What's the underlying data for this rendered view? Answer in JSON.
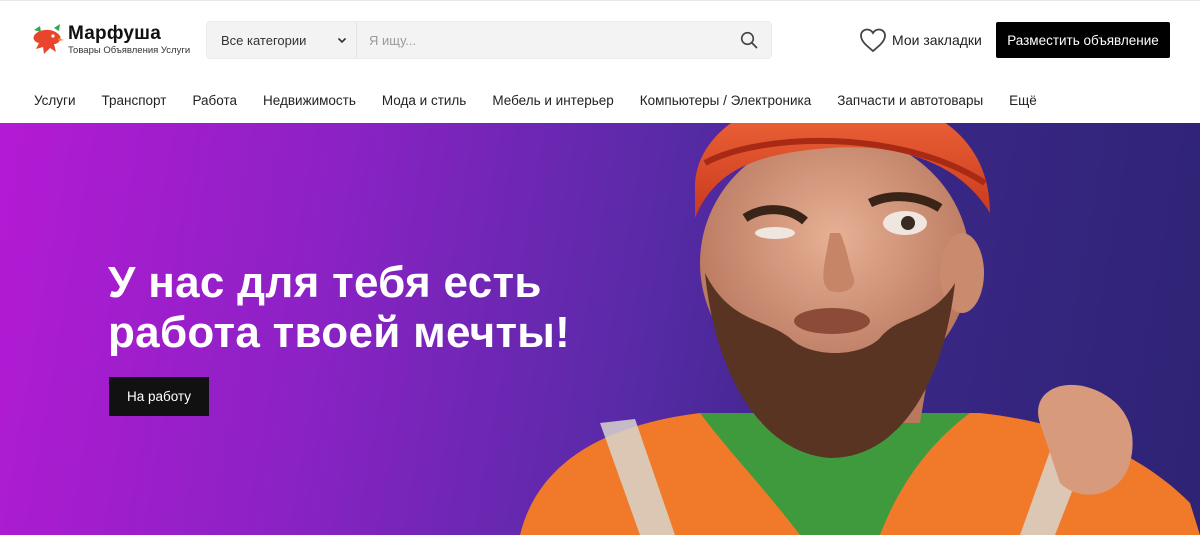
{
  "brand": {
    "name": "Марфуша",
    "tagline": "Товары Объявления Услуги",
    "logo_icon": "dragon-logo-icon"
  },
  "search": {
    "category_label": "Все категории",
    "placeholder": "Я ищу...",
    "value": ""
  },
  "header": {
    "bookmarks_label": "Мои закладки",
    "post_ad_label": "Разместить объявление"
  },
  "nav": {
    "items": [
      {
        "label": "Услуги"
      },
      {
        "label": "Транспорт"
      },
      {
        "label": "Работа"
      },
      {
        "label": "Недвижимость"
      },
      {
        "label": "Мода и стиль"
      },
      {
        "label": "Мебель и интерьер"
      },
      {
        "label": "Компьютеры / Электроника"
      },
      {
        "label": "Запчасти и автотовары"
      },
      {
        "label": "Ещё"
      }
    ]
  },
  "hero": {
    "title_line1": "У нас для тебя есть",
    "title_line2": "работа твоей мечты!",
    "cta_label": "На работу"
  },
  "colors": {
    "accent": "#000000",
    "hero_gradient_start": "#b41ad4",
    "hero_gradient_end": "#2e2374"
  }
}
